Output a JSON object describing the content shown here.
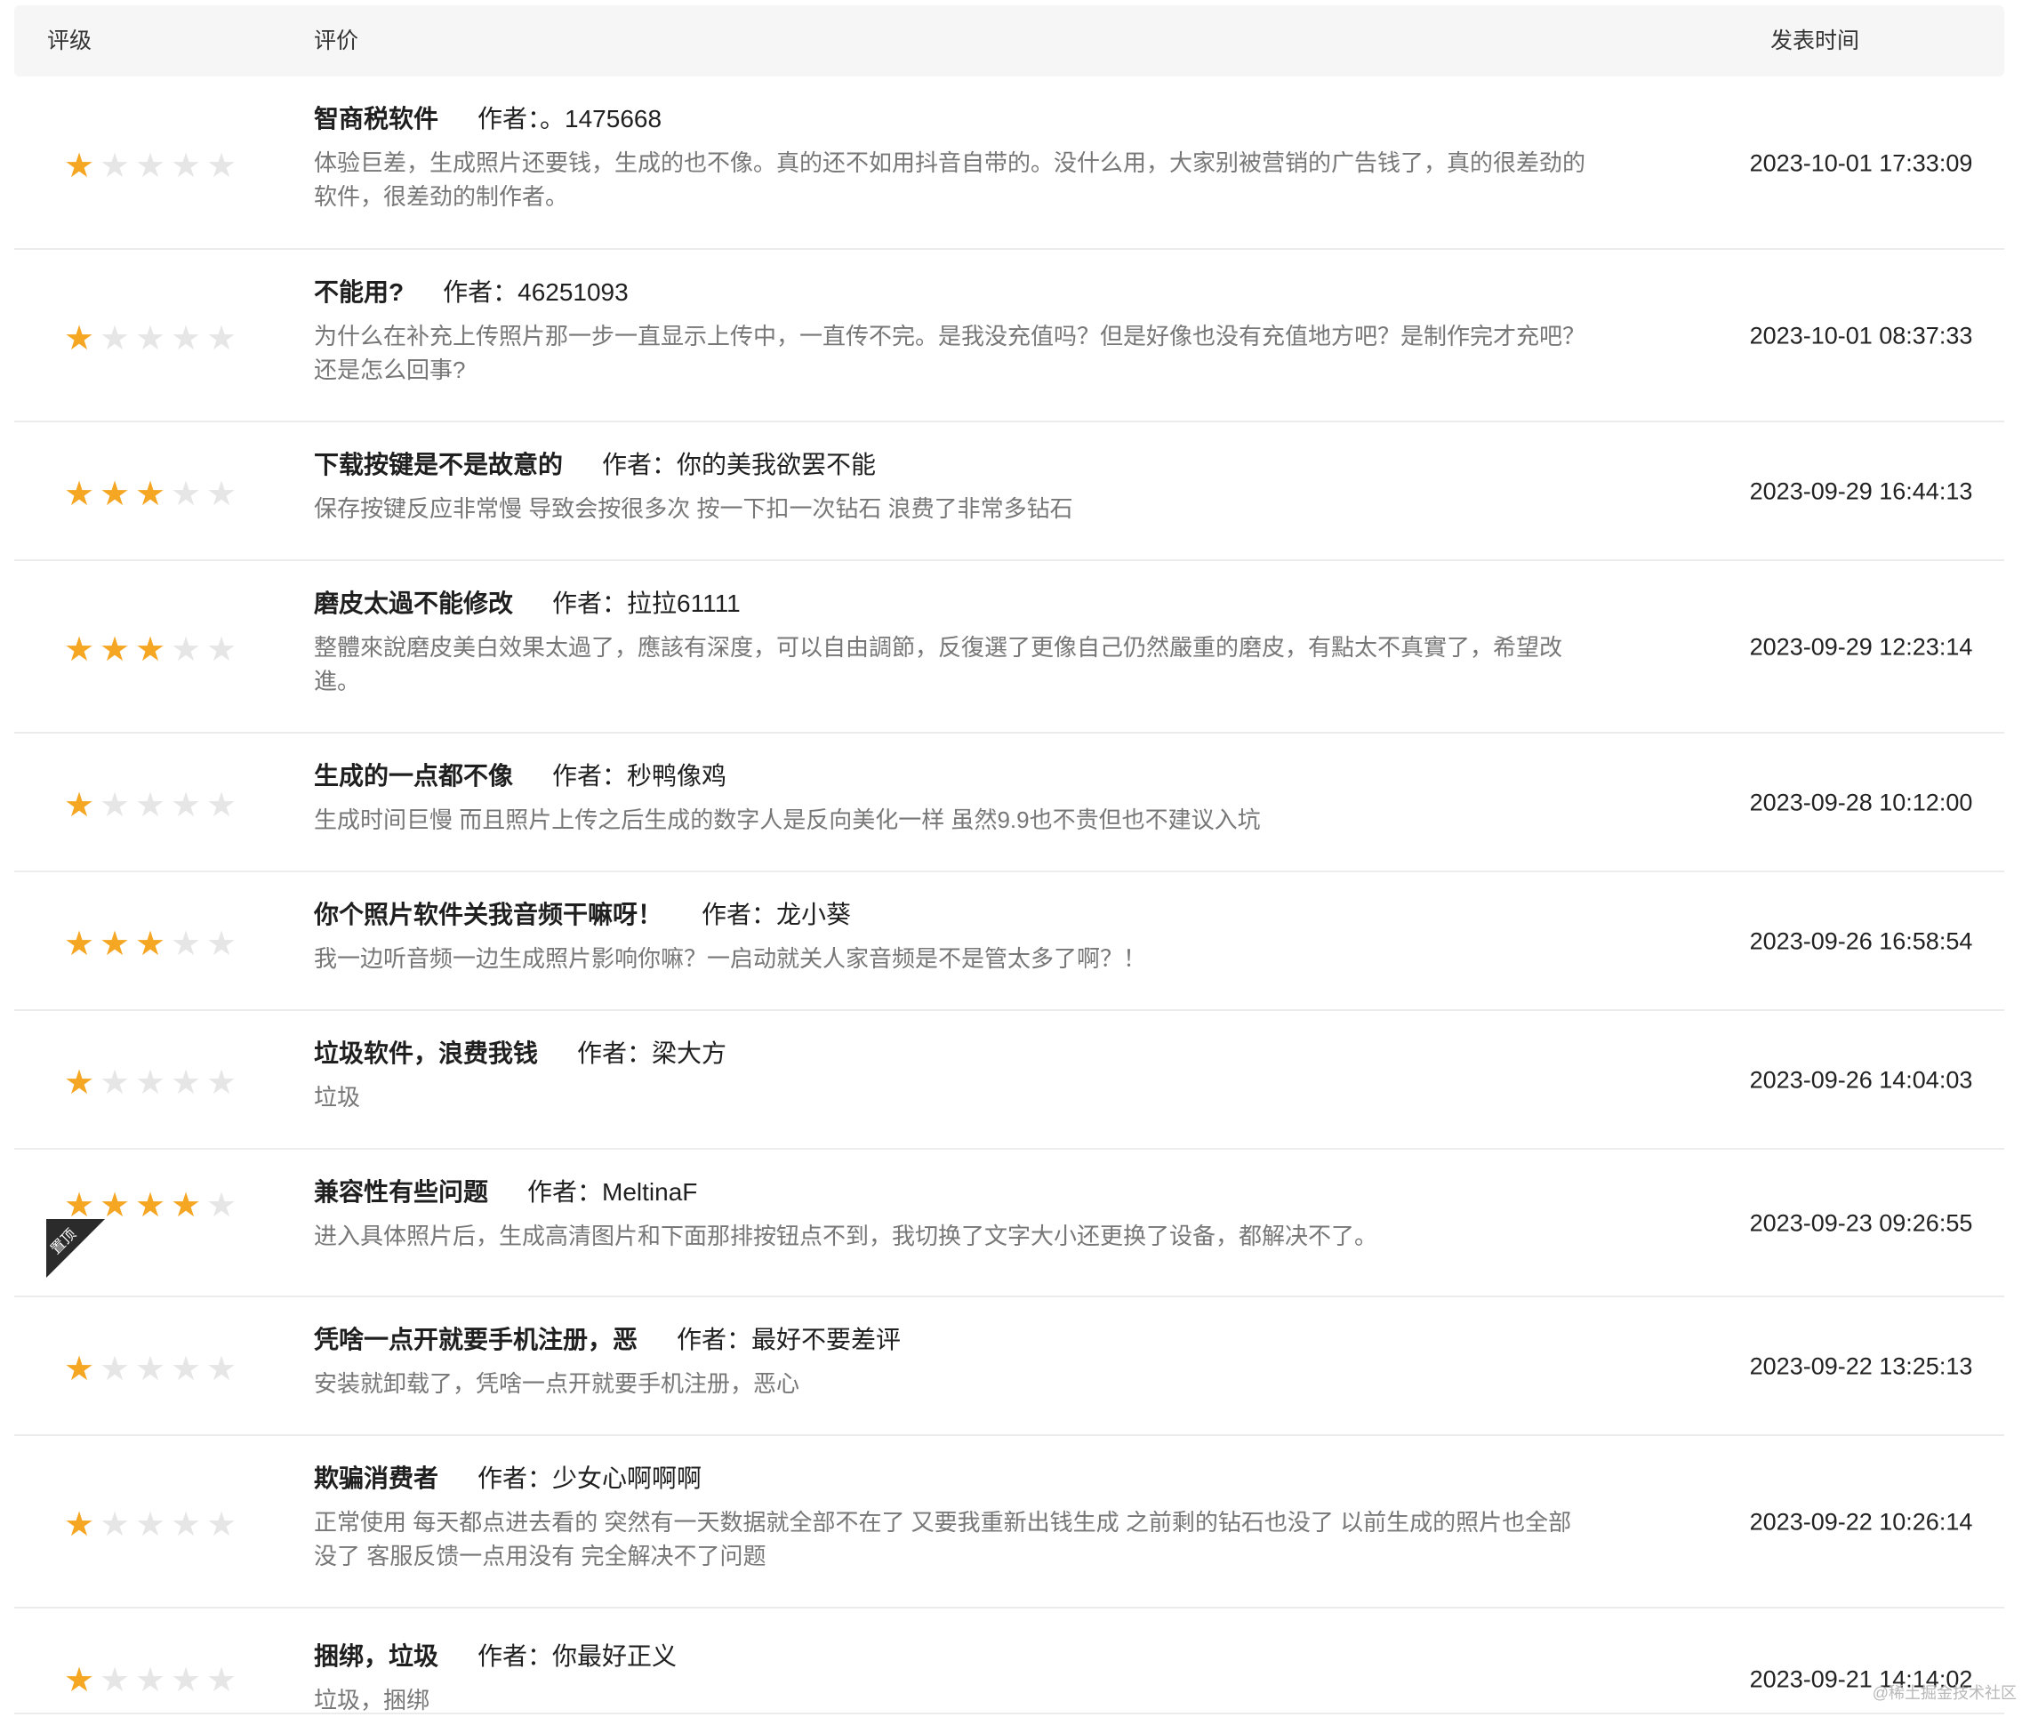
{
  "header": {
    "rating": "评级",
    "review": "评价",
    "time": "发表时间"
  },
  "author_label": "作者：",
  "reviews": [
    {
      "stars": 1,
      "title": "智商税软件",
      "author": "。1475668",
      "content": "体验巨差，生成照片还要钱，生成的也不像。真的还不如用抖音自带的。没什么用，大家别被营销的广告钱了，真的很差劲的软件，很差劲的制作者。",
      "time": "2023-10-01 17:33:09"
    },
    {
      "stars": 1,
      "title": "不能用?",
      "author": "46251093",
      "content": "为什么在补充上传照片那一步一直显示上传中，一直传不完。是我没充值吗？但是好像也没有充值地方吧？是制作完才充吧？还是怎么回事?",
      "time": "2023-10-01 08:37:33"
    },
    {
      "stars": 3,
      "title": "下载按键是不是故意的",
      "author": "你的美我欲罢不能",
      "content": "保存按键反应非常慢 导致会按很多次 按一下扣一次钻石 浪费了非常多钻石",
      "time": "2023-09-29 16:44:13"
    },
    {
      "stars": 3,
      "title": "磨皮太過不能修改",
      "author": "拉拉61111",
      "content": "整體來說磨皮美白效果太過了，應該有深度，可以自由調節，反復選了更像自己仍然嚴重的磨皮，有點太不真實了，希望改進。",
      "time": "2023-09-29 12:23:14"
    },
    {
      "stars": 1,
      "title": "生成的一点都不像",
      "author": "秒鸭像鸡",
      "content": "生成时间巨慢 而且照片上传之后生成的数字人是反向美化一样 虽然9.9也不贵但也不建议入坑",
      "time": "2023-09-28 10:12:00"
    },
    {
      "stars": 3,
      "title": "你个照片软件关我音频干嘛呀！",
      "author": "龙小葵",
      "content": "我一边听音频一边生成照片影响你嘛？一启动就关人家音频是不是管太多了啊？！",
      "time": "2023-09-26 16:58:54"
    },
    {
      "stars": 1,
      "title": "垃圾软件，浪费我钱",
      "author": "梁大方",
      "content": "垃圾",
      "time": "2023-09-26 14:04:03"
    },
    {
      "stars": 4,
      "title": "兼容性有些问题",
      "author": "MeltinaF",
      "content": "进入具体照片后，生成高清图片和下面那排按钮点不到，我切换了文字大小还更换了设备，都解决不了。",
      "time": "2023-09-23 09:26:55",
      "pinned": "置顶"
    },
    {
      "stars": 1,
      "title": "凭啥一点开就要手机注册，恶",
      "author": "最好不要差评",
      "content": "安装就卸载了，凭啥一点开就要手机注册，恶心",
      "time": "2023-09-22 13:25:13"
    },
    {
      "stars": 1,
      "title": "欺骗消费者",
      "author": "少女心啊啊啊",
      "content": "正常使用 每天都点进去看的 突然有一天数据就全部不在了 又要我重新出钱生成 之前剩的钻石也没了 以前生成的照片也全部没了 客服反馈一点用没有 完全解决不了问题",
      "time": "2023-09-22 10:26:14"
    },
    {
      "stars": 1,
      "title": "捆绑，垃圾",
      "author": "你最好正义",
      "content": "垃圾，捆绑",
      "time": "2023-09-21 14:14:02"
    }
  ],
  "watermark": "@稀土掘金技术社区"
}
